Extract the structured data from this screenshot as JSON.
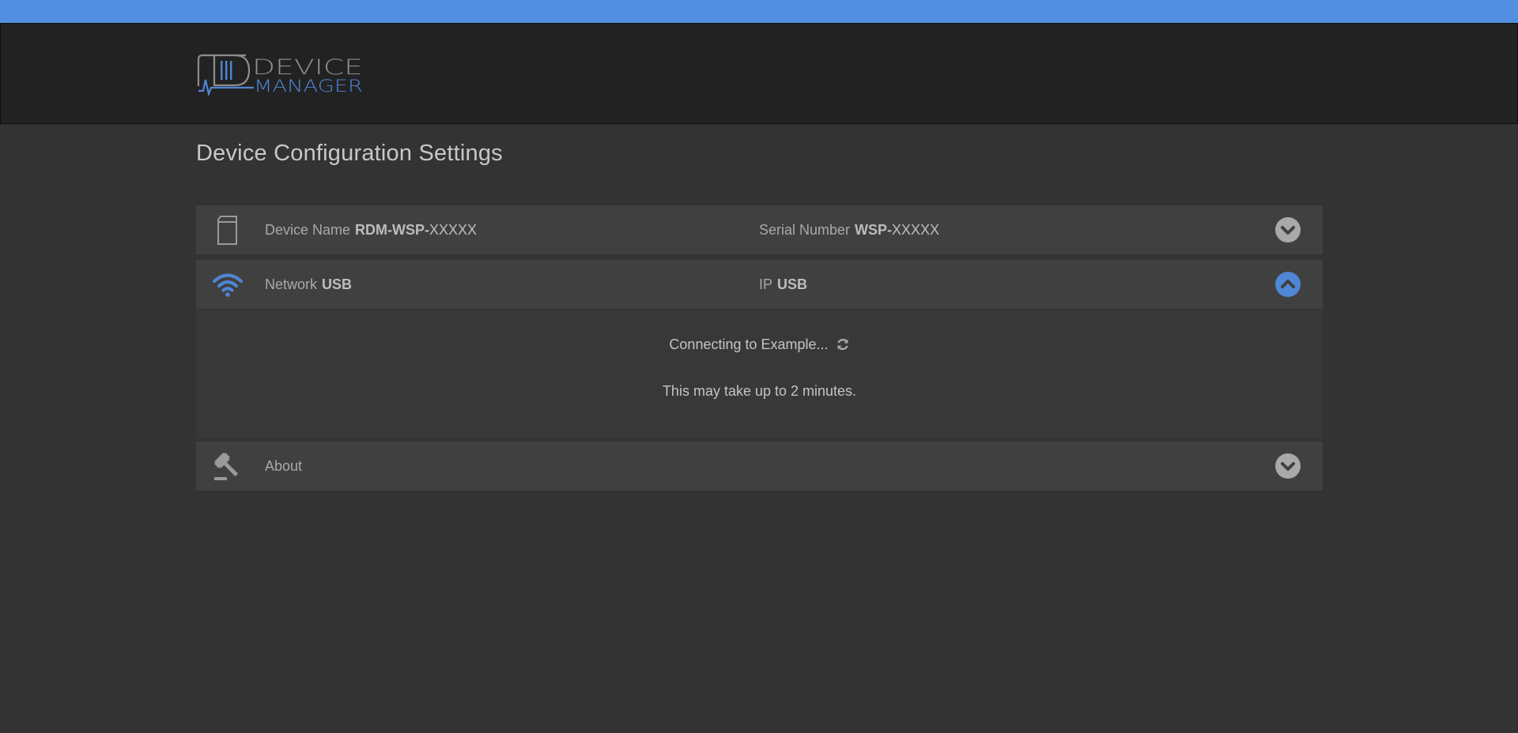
{
  "logo": {
    "line1": "DEVICE",
    "line2": "MANAGER"
  },
  "page": {
    "title": "Device Configuration Settings"
  },
  "device_row": {
    "icon": "device-icon",
    "name_label": "Device Name",
    "name_value_bold": "RDM-WSP-",
    "name_value_rest": "XXXXX",
    "serial_label": "Serial Number",
    "serial_value_bold": "WSP-",
    "serial_value_rest": "XXXXX",
    "toggle_icon": "chevron-down-icon"
  },
  "network_row": {
    "icon": "wifi-icon",
    "network_label": "Network",
    "network_value": "USB",
    "ip_label": "IP",
    "ip_value": "USB",
    "toggle_icon": "chevron-up-icon",
    "connecting_text": "Connecting to Example...",
    "connecting_icon": "refresh-icon",
    "duration_text": "This may take up to 2 minutes."
  },
  "about_row": {
    "icon": "gavel-icon",
    "label": "About",
    "toggle_icon": "chevron-down-icon"
  },
  "colors": {
    "accent": "#538fe0",
    "header_bg": "#222222",
    "page_bg": "#333333",
    "row_bg": "#404040"
  }
}
